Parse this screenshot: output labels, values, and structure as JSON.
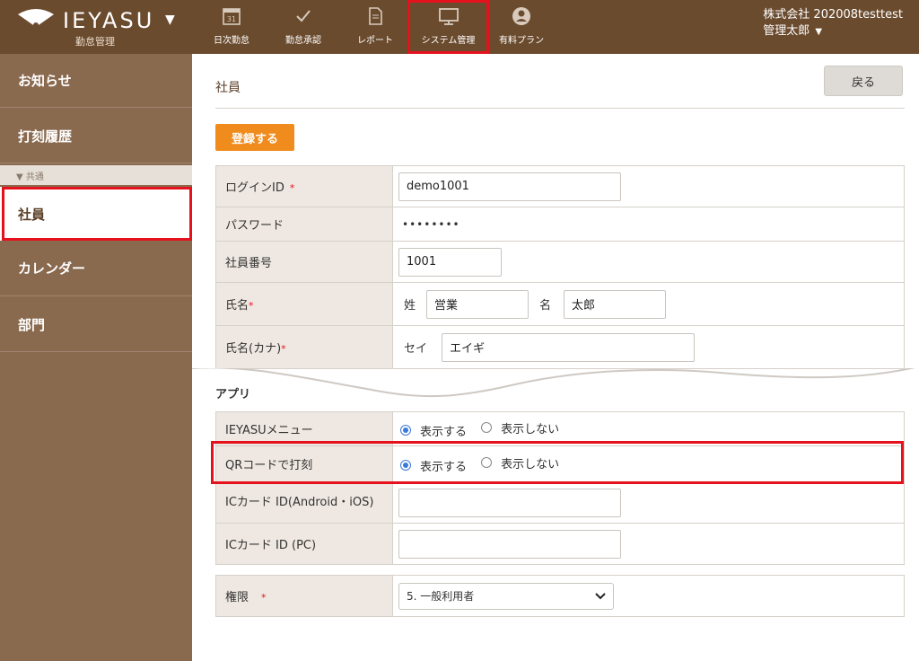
{
  "header": {
    "brand": "IEYASU",
    "brand_sub": "勤怠管理",
    "nav": [
      {
        "label": "日次勤怠",
        "icon": "calendar-icon",
        "icon_text": "31"
      },
      {
        "label": "勤怠承認",
        "icon": "check-icon"
      },
      {
        "label": "レポート",
        "icon": "document-icon"
      },
      {
        "label": "システム管理",
        "icon": "monitor-icon"
      },
      {
        "label": "有料プラン",
        "icon": "user-circle-icon"
      }
    ],
    "company": "株式会社 202008testtest",
    "user_name": "管理太郎"
  },
  "sidebar": {
    "items": [
      {
        "label": "お知らせ"
      },
      {
        "label": "打刻履歴"
      },
      {
        "label": "社員"
      },
      {
        "label": "カレンダー"
      },
      {
        "label": "部門"
      }
    ],
    "section_label": "▼ 共通"
  },
  "main": {
    "title": "社員",
    "back_label": "戻る",
    "register_label": "登録する",
    "required_mark": "*",
    "fields": {
      "login_id": {
        "label": "ログインID",
        "value": "demo1001"
      },
      "password": {
        "label": "パスワード",
        "value": "••••••••"
      },
      "employee_no": {
        "label": "社員番号",
        "value": "1001"
      },
      "name": {
        "label": "氏名",
        "sei_label": "姓",
        "sei": "営業",
        "mei_label": "名",
        "mei": "太郎"
      },
      "name_kana": {
        "label": "氏名(カナ)",
        "sei_label": "セイ",
        "sei": "エイギ"
      }
    },
    "app_section": "アプリ",
    "app_rows": [
      {
        "label": "IEYASUメニュー",
        "opt_show": "表示する",
        "opt_hide": "表示しない",
        "selected": "show"
      },
      {
        "label": "QRコードで打刻",
        "opt_show": "表示する",
        "opt_hide": "表示しない",
        "selected": "show"
      }
    ],
    "ic_android_label": "ICカード ID(Android・iOS)",
    "ic_pc_label": "ICカード ID (PC)",
    "permission": {
      "label": "権限",
      "value": "5. 一般利用者"
    }
  },
  "colors": {
    "header": "#6b4b2e",
    "sidebar": "#8a6a4f",
    "accent": "#f08c1e",
    "highlight": "#e5121d",
    "radio": "#3b7ad9"
  }
}
